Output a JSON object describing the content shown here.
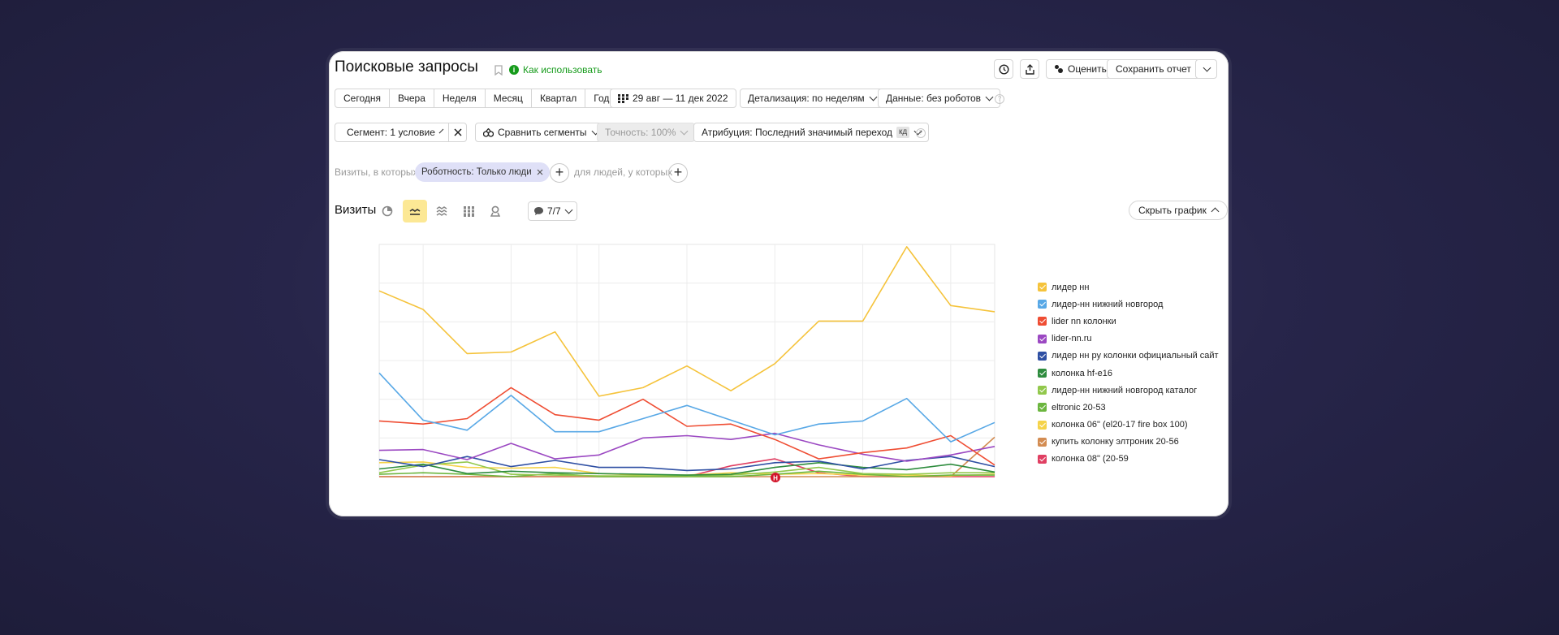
{
  "header": {
    "title": "Поисковые запросы",
    "howto_label": "Как использовать",
    "rate_label": "Оценить",
    "save_label": "Сохранить отчет"
  },
  "periods": [
    "Сегодня",
    "Вчера",
    "Неделя",
    "Месяц",
    "Квартал",
    "Год"
  ],
  "date_range": "29 авг — 11 дек 2022",
  "detail_label": "Детализация: по неделям",
  "data_label": "Данные: без роботов",
  "segment_label": "Сегмент: 1 условие",
  "compare_label": "Сравнить сегменты",
  "accuracy_label": "Точность: 100%",
  "attribution_label": "Атрибуция: Последний значимый переход",
  "attribution_badge": "кд",
  "filter": {
    "visits_label": "Визиты, в которых",
    "chip_label": "Роботность: Только люди",
    "people_label": "для людей, у которых"
  },
  "chart_header": {
    "title": "Визиты",
    "notes_label": "7/7",
    "hide_label": "Скрыть график"
  },
  "colors": {
    "accent_green": "#169b1b",
    "active_tab": "#fce895"
  },
  "chart_data": {
    "type": "line",
    "ylim": [
      0,
      30
    ],
    "xlabel": "",
    "ylabel": "",
    "annotation_marker": "Н",
    "series": [
      {
        "name": "лидер нн",
        "color": "#f5c33b",
        "values": [
          24,
          21.6,
          15.9,
          16.1,
          18.7,
          10.4,
          11.5,
          14.3,
          11.1,
          14.6,
          20.1,
          20.1,
          29.7,
          22.1,
          21.3
        ]
      },
      {
        "name": "лидер-нн нижний новгород",
        "color": "#58a8e6",
        "values": [
          13.4,
          7.3,
          6,
          10.5,
          5.8,
          5.8,
          7.5,
          9.2,
          7.3,
          5.4,
          6.8,
          7.2,
          10.1,
          4.5,
          7
        ]
      },
      {
        "name": "lider nn колонки",
        "color": "#ef4d33",
        "values": [
          7.2,
          6.8,
          7.5,
          11.5,
          8,
          7.3,
          10,
          6.5,
          6.8,
          4.8,
          2.3,
          3.1,
          3.7,
          5.3,
          1.5
        ]
      },
      {
        "name": "lider-nn.ru",
        "color": "#9b48c2",
        "values": [
          3.4,
          3.5,
          2.2,
          4.3,
          2.3,
          2.8,
          5,
          5.3,
          4.8,
          5.6,
          4.1,
          2.9,
          2,
          2.8,
          3.9
        ]
      },
      {
        "name": "лидер нн ру колонки официальный сайт",
        "color": "#2e4fa3",
        "values": [
          2.2,
          1.3,
          2.6,
          1.3,
          2.1,
          1.2,
          1.2,
          0.8,
          1,
          1.8,
          2,
          1,
          2.1,
          2.6,
          1.3
        ]
      },
      {
        "name": "колонка hf-e16",
        "color": "#2e8c3e",
        "values": [
          1,
          1.6,
          0.4,
          0.7,
          0.5,
          0.4,
          0.3,
          0.2,
          0.3,
          1.2,
          1.8,
          1.2,
          0.9,
          1.6,
          0.6
        ]
      },
      {
        "name": "лидер-нн нижний новгород каталог",
        "color": "#92c84c",
        "values": [
          0.5,
          1.5,
          1.9,
          0.3,
          0.2,
          0.1,
          0.1,
          0.1,
          0.2,
          0.6,
          1.2,
          0.4,
          0.3,
          0.5,
          0.5
        ]
      },
      {
        "name": "eltronic 20-53",
        "color": "#6cb63f",
        "values": [
          0.3,
          0.5,
          0.3,
          0,
          0.4,
          0,
          0,
          0,
          0,
          0.3,
          0.7,
          0.3,
          0,
          0.2,
          0.2
        ]
      },
      {
        "name": "колонка 06\" (el20-17 fire box 100)",
        "color": "#f5d34a",
        "values": [
          1.8,
          1.9,
          1.2,
          1.1,
          1.2,
          0.4,
          0.2,
          0.2,
          0.5,
          0.3,
          0.4,
          0.2,
          0.2,
          0.1,
          0.3
        ]
      },
      {
        "name": "купить колонку элтроник 20-56",
        "color": "#d38c52",
        "values": [
          0,
          0,
          0,
          0,
          0,
          0,
          0,
          0,
          0,
          0,
          0,
          0,
          0,
          0,
          5.1
        ]
      },
      {
        "name": "колонка 08\" (20-59",
        "color": "#e03f62",
        "values": [
          0,
          0,
          0,
          0,
          0,
          0,
          0,
          0,
          1.4,
          2.3,
          0.5,
          0,
          0,
          0,
          0
        ]
      }
    ]
  }
}
